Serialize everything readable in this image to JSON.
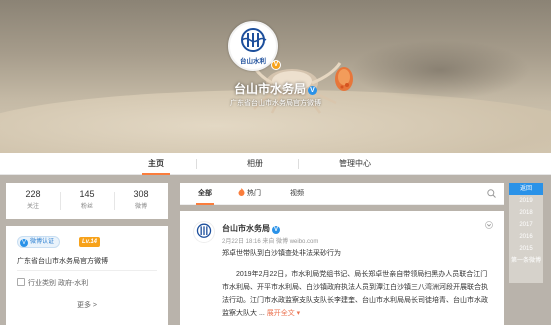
{
  "profile": {
    "name": "台山市水务局",
    "description": "广东省台山市水务局官方微博",
    "avatar_text": "台山水利"
  },
  "tabs": [
    {
      "label": "主页",
      "active": true
    },
    {
      "label": "相册",
      "active": false
    },
    {
      "label": "管理中心",
      "active": false
    }
  ],
  "stats": [
    {
      "value": "228",
      "label": "关注"
    },
    {
      "value": "145",
      "label": "粉丝"
    },
    {
      "value": "308",
      "label": "微博"
    }
  ],
  "info": {
    "verify_label": "微博认证",
    "level": "Lv.14",
    "description": "广东省台山市水务局官方微博",
    "industry": "行业类别 政府-水利",
    "more": "更多 >"
  },
  "feed_tabs": [
    {
      "label": "全部",
      "active": true
    },
    {
      "label": "热门",
      "active": false
    },
    {
      "label": "视频",
      "active": false
    }
  ],
  "post": {
    "author": "台山市水务局",
    "meta": "2月22日 18:16 来自 微博 weibo.com",
    "title": "郑卓世带队到白沙镇查处非法采砂行为",
    "body": "2019年2月22日，市水利局党组书记、局长郑卓世亲自带领局扫黑办人员联合江门市水利局、开平市水利局、白沙镇政府执法人员到潭江白沙镇三八湾洲河段开展联合执法行动。江门市水政监察支队支队长李建奎、台山市水利局局长司徒培青、台山市水政监察大队大 ...",
    "expand": "展开全文 ▾"
  },
  "timeline": {
    "years": [
      "返回",
      "2019",
      "2018",
      "2017",
      "2016",
      "2015",
      "第一条微博"
    ],
    "active_index": 0
  },
  "colors": {
    "accent": "#fa7d3c",
    "link_blue": "#2a92e8",
    "verify_gold": "#f7a21b"
  }
}
